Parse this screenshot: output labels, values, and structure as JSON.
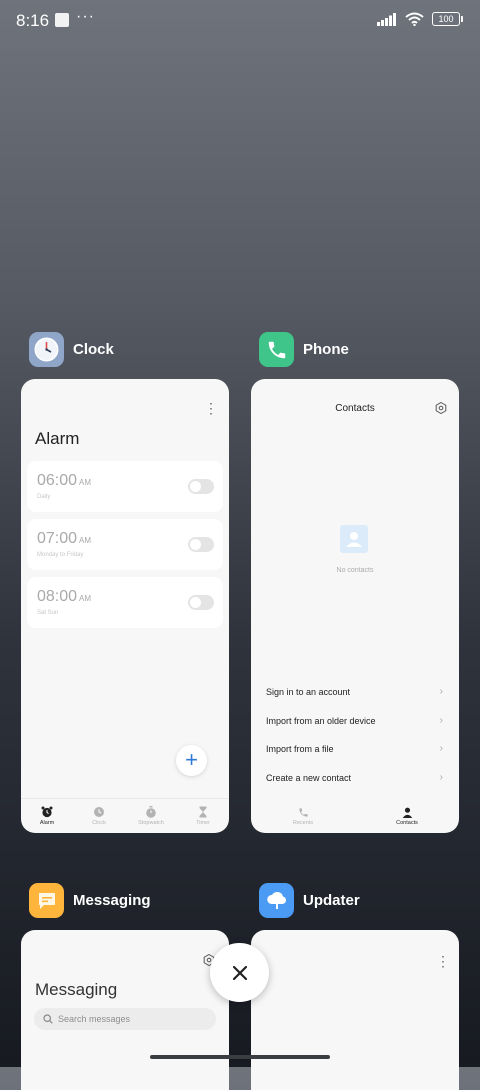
{
  "status_bar": {
    "time": "8:16",
    "dots": "···",
    "battery": "100"
  },
  "clock": {
    "app_name": "Clock",
    "title": "Alarm",
    "alarms": [
      {
        "time": "06:00",
        "ampm": "AM",
        "repeat": "Daily"
      },
      {
        "time": "07:00",
        "ampm": "AM",
        "repeat": "Monday to Friday"
      },
      {
        "time": "08:00",
        "ampm": "AM",
        "repeat": "Sat Sun"
      }
    ],
    "add_glyph": "+",
    "tabs": [
      {
        "label": "Alarm",
        "icon": "alarm-icon",
        "active": true
      },
      {
        "label": "Clock",
        "icon": "clock-icon",
        "active": false
      },
      {
        "label": "Stopwatch",
        "icon": "stopwatch-icon",
        "active": false
      },
      {
        "label": "Timer",
        "icon": "timer-icon",
        "active": false
      }
    ]
  },
  "phone": {
    "app_name": "Phone",
    "title": "Contacts",
    "empty_text": "No contacts",
    "options": [
      "Sign in to an account",
      "Import from an older device",
      "Import from a file",
      "Create a new contact"
    ],
    "tabs": [
      {
        "label": "Recents",
        "icon": "phone-icon",
        "active": false
      },
      {
        "label": "Contacts",
        "icon": "person-icon",
        "active": true
      }
    ]
  },
  "messaging": {
    "app_name": "Messaging",
    "title": "Messaging",
    "search_placeholder": "Search messages"
  },
  "updater": {
    "app_name": "Updater"
  },
  "colors": {
    "clock_icon_bg": "#8fa6c8",
    "phone_icon_bg": "#3fc48a",
    "messaging_icon_bg": "#ffb53c",
    "updater_icon_bg": "#4b9bf5",
    "accent_blue": "#2f7ad9"
  }
}
